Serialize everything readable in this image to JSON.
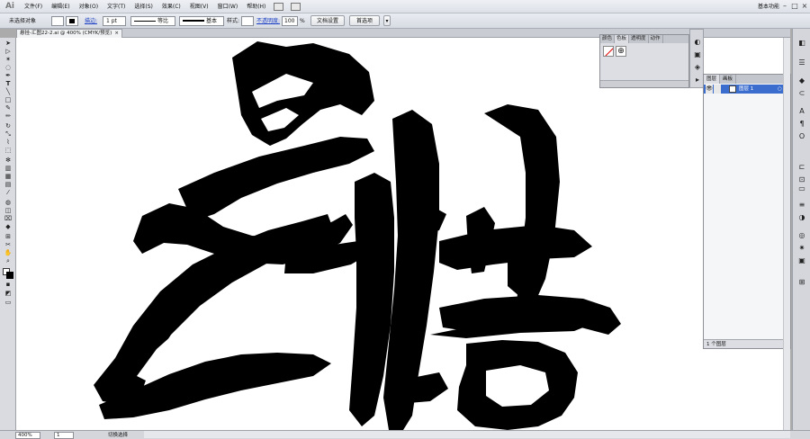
{
  "app_logo": "Ai",
  "menu": [
    "文件(F)",
    "编辑(E)",
    "对象(O)",
    "文字(T)",
    "选择(S)",
    "效果(C)",
    "视图(V)",
    "窗口(W)",
    "帮助(H)"
  ],
  "workspace": "基本功能",
  "control": {
    "selection_label": "未选择对象",
    "stroke_label": "描边:",
    "stroke_weight": "1 pt",
    "profile_label": "等比",
    "brush_label": "基本",
    "style_label": "样式:",
    "opacity_label": "不透明度:",
    "opacity_value": "100",
    "percent": "%",
    "doc_setup_button": "文档设置",
    "prefs_button": "首选项"
  },
  "document_tab": "悬挂-汇图22-2.ai @ 400% (CMYK/预览)",
  "color_panel": {
    "tabs": [
      "颜色",
      "色板",
      "透明度",
      "动作"
    ]
  },
  "layers_panel": {
    "tabs": [
      "图层",
      "画板"
    ],
    "layer_name": "图层 1",
    "footer": "1 个图层"
  },
  "status": {
    "zoom": "400%",
    "page": "1",
    "mode": "切换选择"
  },
  "colors": {
    "chrome": "#d4d6db",
    "selection": "#3b6dce",
    "ink": "#000000",
    "canvas": "#ffffff"
  },
  "icons": [
    "selection-tool-icon",
    "direct-select-icon",
    "magic-wand-icon",
    "lasso-icon",
    "pen-icon",
    "type-icon",
    "line-icon",
    "rectangle-icon",
    "paintbrush-icon",
    "pencil-icon",
    "rotate-icon",
    "scale-icon",
    "warp-icon",
    "free-transform-icon",
    "symbol-sprayer-icon",
    "column-graph-icon",
    "mesh-icon",
    "gradient-icon",
    "eyedropper-icon",
    "blend-icon",
    "live-paint-icon",
    "slice-icon",
    "eraser-icon",
    "hand-icon",
    "zoom-icon",
    "fill-stroke-icon",
    "screen-mode-icon",
    "eye-icon",
    "lock-icon"
  ]
}
